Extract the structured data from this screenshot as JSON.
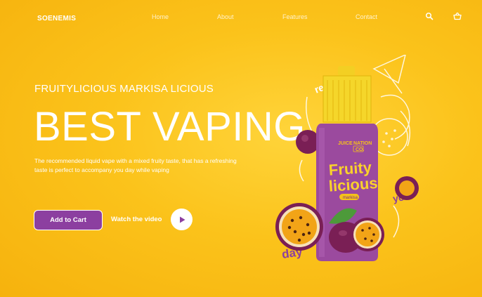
{
  "nav": {
    "brand": "SOENEMIS",
    "links": [
      "Home",
      "About",
      "Features",
      "Contact"
    ],
    "icons": [
      "search-icon",
      "basket-icon"
    ]
  },
  "hero": {
    "subtitle": "FRUITYLICIOUS MARKISA LICIOUS",
    "headline": "BEST VAPING",
    "description": "The recommended liquid vape with a mixed fruity taste, that has a refreshing taste is perfect to accompany you day while vaping",
    "cart_label": "Add to Cart",
    "video_label": "Watch the video"
  },
  "product": {
    "brand_a": "JUICE",
    "brand_b": "NATION",
    "brand_c": "CO.",
    "name_1": "Fruity",
    "name_2": "licious",
    "flavor": "markisa",
    "doodle_words": [
      "refresh",
      "your",
      "day"
    ]
  },
  "colors": {
    "background": "#fbc31b",
    "button": "#8c3fa0",
    "bottle": "#9b4a9e",
    "cap": "#f5d62a"
  }
}
